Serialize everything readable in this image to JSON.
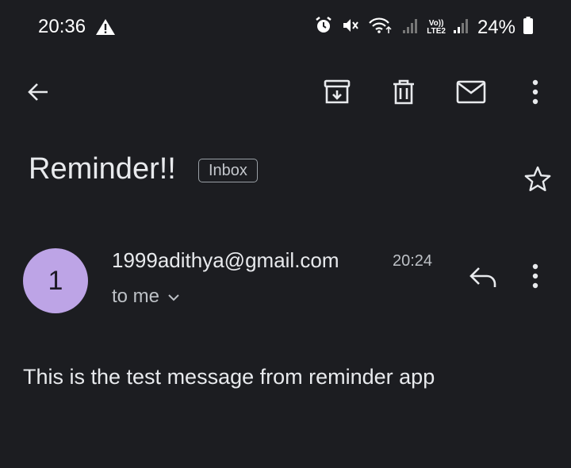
{
  "status_bar": {
    "time": "20:36",
    "volte_top": "Vo))",
    "volte_bottom": "LTE2",
    "battery": "24%",
    "icons": [
      "warning-icon",
      "alarm-icon",
      "mute-icon",
      "wifi-icon",
      "signal-icon",
      "battery-icon"
    ]
  },
  "toolbar": {
    "back": "back-arrow-icon",
    "archive": "archive-icon",
    "delete": "delete-icon",
    "mark_unread": "mail-icon",
    "more": "more-vert-icon"
  },
  "email": {
    "subject": "Reminder!!",
    "label": "Inbox",
    "avatar_letter": "1",
    "avatar_color": "#bda4e6",
    "sender": "1999adithya@gmail.com",
    "time": "20:24",
    "recipient": "to me",
    "body": "This is the test message from reminder app"
  },
  "colors": {
    "background": "#1c1d21",
    "text": "#e8eaed"
  }
}
